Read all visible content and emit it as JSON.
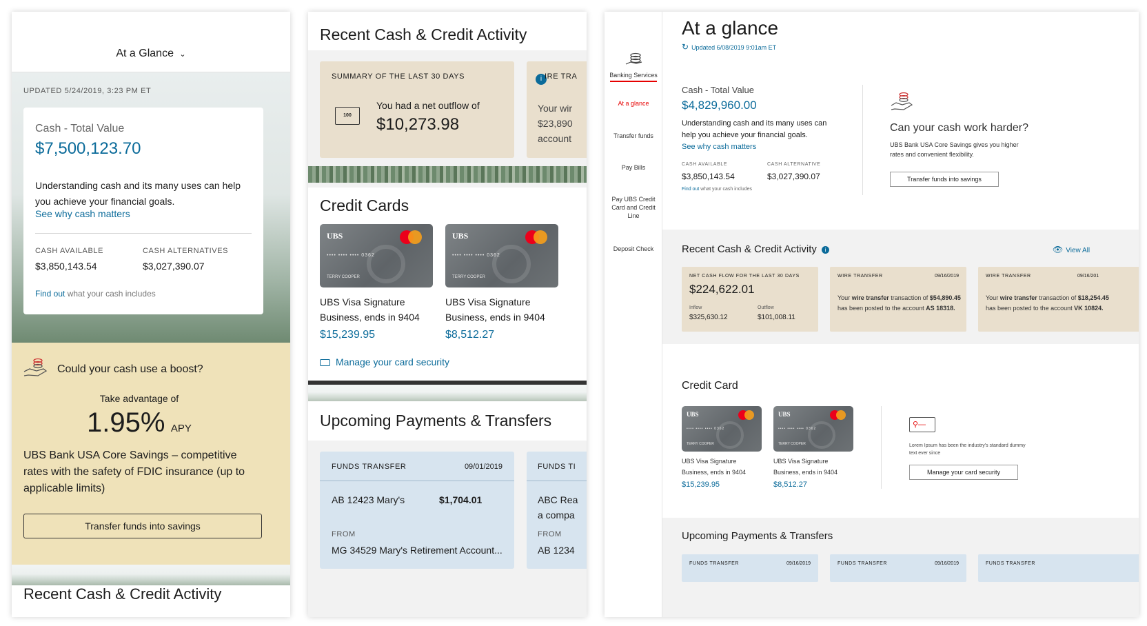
{
  "panel1": {
    "header_title": "At a Glance",
    "updated": "UPDATED 5/24/2019, 3:23 PM ET",
    "cash_label": "Cash - Total Value",
    "cash_value": "$7,500,123.70",
    "cash_desc": "Understanding cash and its many uses can help you achieve your financial goals.",
    "cash_link": "See why cash matters",
    "avail_label": "CASH AVAILABLE",
    "avail_value": "$3,850,143.54",
    "alt_label": "CASH ALTERNATIVES",
    "alt_value": "$3,027,390.07",
    "find_out_link": "Find out",
    "find_out_rest": "what your cash includes",
    "promo_title": "Could your cash use a boost?",
    "promo_take": "Take advantage of",
    "promo_rate": "1.95%",
    "promo_apy": "APY",
    "promo_desc": "UBS Bank USA Core Savings – competitive rates with the safety of FDIC insurance (up to applicable limits)",
    "promo_button": "Transfer funds into savings",
    "bottom_heading": "Recent Cash & Credit Activity"
  },
  "panel2": {
    "heading": "Recent Cash & Credit Activity",
    "summary_label": "SUMMARY OF THE LAST 30 DAYS",
    "summary_text": "You had a net outflow of",
    "summary_value": "$10,273.98",
    "wire_label_partial": "IRE TRA",
    "wire_text_1": "Your wir",
    "wire_text_2": "$23,890",
    "wire_text_3": "account",
    "credit_heading": "Credit Cards",
    "cards": [
      {
        "name": "UBS Visa Signature Business, ends in 9404",
        "value": "$15,239.95"
      },
      {
        "name": "UBS Visa Signature Business, ends in 9404",
        "value": "$8,512.27"
      }
    ],
    "card_logo": "UBS",
    "card_number": "•••• •••• •••• 0362",
    "card_holder": "TERRY COOPER",
    "manage_link": "Manage your card security",
    "upcoming_heading": "Upcoming Payments & Transfers",
    "transfer1": {
      "label": "FUNDS TRANSFER",
      "date": "09/01/2019",
      "to": "AB 12423 Mary's",
      "amount": "$1,704.01",
      "from_label": "FROM",
      "from": "MG 34529 Mary's Retirement Account..."
    },
    "transfer2": {
      "label": "FUNDS TI",
      "to_1": "ABC Rea",
      "to_2": "a compa",
      "from_label": "FROM",
      "from": "AB 1234"
    }
  },
  "panel3": {
    "nav": {
      "banking": "Banking Services",
      "items": [
        "At a glance",
        "Transfer funds",
        "Pay Bills",
        "Pay UBS Credit Card and Credit Line",
        "Deposit Check"
      ]
    },
    "title": "At a glance",
    "updated": "Updated 6/08/2019 9:01am ET",
    "cash_label": "Cash - Total Value",
    "cash_value": "$4,829,960.00",
    "cash_desc": "Understanding cash and its many uses can help you achieve your financial goals.",
    "cash_link": "See why cash matters",
    "avail_label": "CASH AVAILABLE",
    "avail_value": "$3,850,143.54",
    "alt_label": "CASH ALTERNATIVE",
    "alt_value": "$3,027,390.07",
    "find_out_link": "Find out",
    "find_out_rest": "what your cash includes",
    "promo_title": "Can your cash work harder?",
    "promo_desc": "UBS Bank USA Core Savings gives you higher rates and convenient flexibility.",
    "promo_button": "Transfer funds into savings",
    "activity_heading": "Recent Cash & Credit Activity",
    "view_all": "View All",
    "net_label": "NET CASH FLOW FOR THE LAST 30 DAYS",
    "net_value": "$224,622.01",
    "inflow_label": "Inflow",
    "inflow_value": "$325,630.12",
    "outflow_label": "Outflow",
    "outflow_value": "$101,008.11",
    "wires": [
      {
        "label": "WIRE TRANSFER",
        "date": "09/16/2019",
        "pre": "Your",
        "bold1": "wire transfer",
        "mid": "transaction of",
        "amount": "$54,890.45",
        "post": "has been posted to the account",
        "account": "AS 18318."
      },
      {
        "label": "WIRE TRANSFER",
        "date": "09/16/201",
        "pre": "Your",
        "bold1": "wire transfer",
        "mid": "transaction of",
        "amount": "$18,254.45",
        "post": "has been posted to the account",
        "account": "VK 10824."
      }
    ],
    "credit_heading": "Credit Card",
    "cards": [
      {
        "name_1": "UBS Visa Signature",
        "name_2": "Business, ends in 9404",
        "value": "$15,239.95"
      },
      {
        "name_1": "UBS Visa Signature",
        "name_2": "Business, ends in 9404",
        "value": "$8,512.27"
      }
    ],
    "security_text": "Lorem Ipsum has been the industry's standard dummy text ever since",
    "security_button": "Manage your card security",
    "upcoming_heading": "Upcoming Payments & Transfers",
    "transfers": [
      {
        "label": "FUNDS TRANSFER",
        "date": "09/16/2019"
      },
      {
        "label": "FUNDS TRANSFER",
        "date": "09/16/2019"
      },
      {
        "label": "FUNDS TRANSFER",
        "date": ""
      }
    ]
  },
  "colors": {
    "accent_blue": "#0b6b9a",
    "tan": "#e9dfcd",
    "promo_yellow": "#efe2b9",
    "light_blue": "#d7e4ef",
    "red": "#e60000"
  }
}
